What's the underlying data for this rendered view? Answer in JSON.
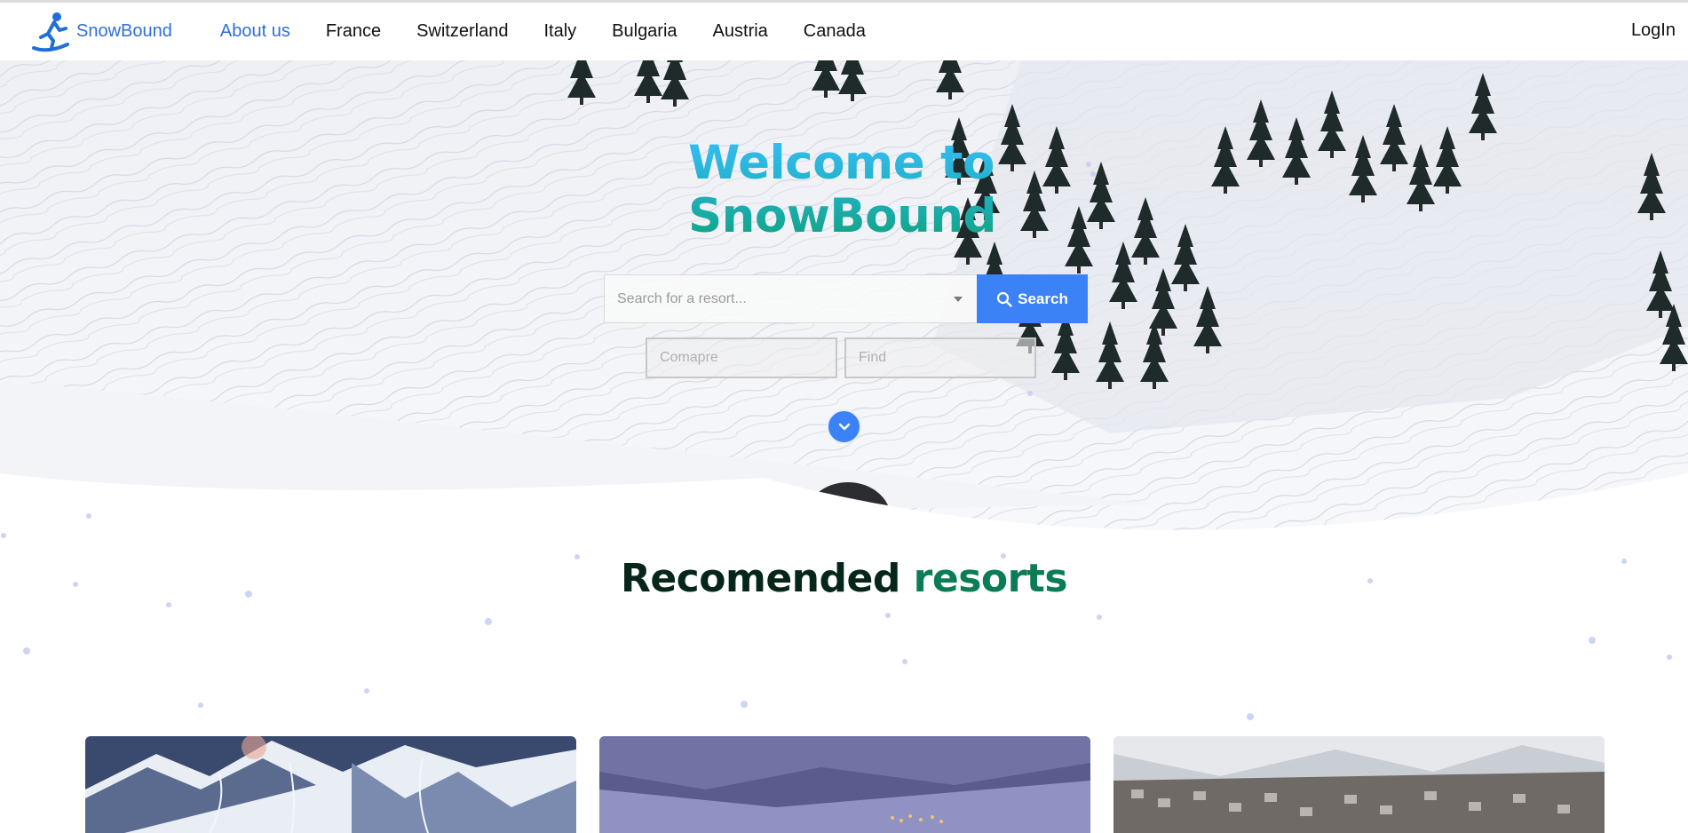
{
  "brand": {
    "name": "SnowBound",
    "logo_icon": "snowboarder-icon",
    "color": "#2f6fdb"
  },
  "nav": {
    "items": [
      {
        "label": "About us",
        "active": true
      },
      {
        "label": "France"
      },
      {
        "label": "Switzerland"
      },
      {
        "label": "Italy"
      },
      {
        "label": "Bulgaria"
      },
      {
        "label": "Austria"
      },
      {
        "label": "Canada"
      }
    ],
    "login_label": "LogIn"
  },
  "hero": {
    "title_line1": "Welcome to",
    "title_line2": "SnowBound",
    "search": {
      "placeholder": "Search for a resort...",
      "button_label": "Search",
      "button_color": "#3b82f6"
    },
    "compare_placeholder": "Comapre",
    "find_placeholder": "Find",
    "scroll_icon": "chevron-down-icon"
  },
  "recommended": {
    "title_part1": "Recomended",
    "title_part2": "resorts"
  },
  "colors": {
    "accent": "#3b82f6",
    "title_gradient_top": "#38bdf8",
    "title_gradient_bottom": "#10a37f",
    "heading_dark": "#06261a",
    "heading_green": "#0a7d55"
  }
}
